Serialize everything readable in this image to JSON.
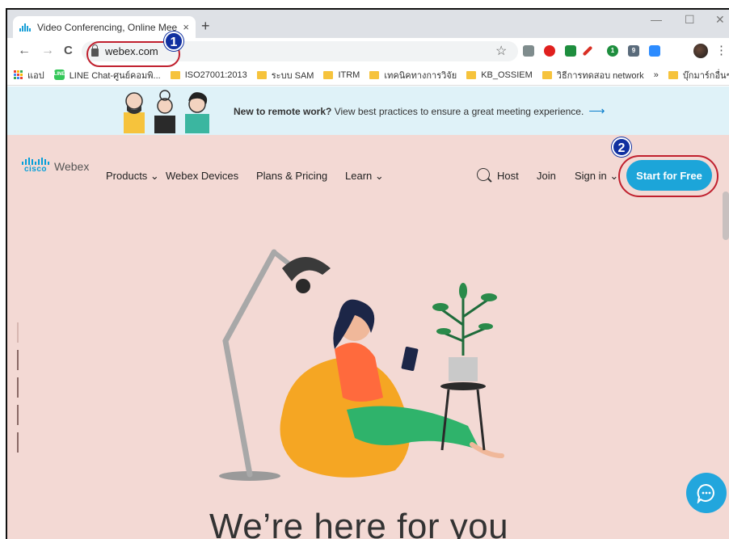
{
  "browser": {
    "tab_title": "Video Conferencing, Online Mee",
    "tab_close": "×",
    "new_tab": "+",
    "window_controls": {
      "minimize": "—",
      "maximize": "☐",
      "close": "✕"
    },
    "back": "←",
    "forward": "→",
    "reload": "C",
    "url": "webex.com",
    "bookmark_star": "☆",
    "menu": "⋮",
    "extensions": [
      {
        "icon": "g-extension-icon",
        "color": "#7f8c8d"
      },
      {
        "icon": "opera-icon",
        "color": "#e0201e"
      },
      {
        "icon": "cast-icon",
        "color": "#1e8e3e"
      },
      {
        "icon": "hammer-icon",
        "color": "#d93025"
      },
      {
        "icon": "extension-badge-icon",
        "color": "#1e8e3e",
        "badge": "1"
      },
      {
        "icon": "gmail-badge-icon",
        "color": "#5a6b7b",
        "badge": "9"
      },
      {
        "icon": "zoom-icon",
        "color": "#2d8cff"
      }
    ]
  },
  "bookmarks": {
    "apps_label": "แอป",
    "items": [
      {
        "label": "LINE Chat-ศูนย์คอมพิ...",
        "icon": "line-icon"
      },
      {
        "label": "ISO27001:2013",
        "icon": "folder-icon"
      },
      {
        "label": "ระบบ SAM",
        "icon": "folder-icon"
      },
      {
        "label": "ITRM",
        "icon": "folder-icon"
      },
      {
        "label": "เทคนิคทางการวิจัย",
        "icon": "folder-icon"
      },
      {
        "label": "KB_OSSIEM",
        "icon": "folder-icon"
      },
      {
        "label": "วิธีการทดสอบ network",
        "icon": "folder-icon"
      }
    ],
    "more": "»",
    "other_bookmarks": "บุ๊กมาร์กอื่นๆ"
  },
  "banner": {
    "bold": "New to remote work?",
    "text": " View best practices to ensure a great meeting experience.",
    "arrow": "⟶"
  },
  "site_nav": {
    "logo_cisco": "cisco",
    "logo_webex": "Webex",
    "products": "Products ⌄",
    "devices": "Webex Devices",
    "pricing": "Plans & Pricing",
    "learn": "Learn ⌄",
    "host": "Host",
    "join": "Join",
    "signin": "Sign in ⌄",
    "cta": "Start for Free"
  },
  "annotations": {
    "one": "1",
    "two": "2"
  },
  "hero": {
    "headline": "We’re here for you"
  },
  "colors": {
    "page_bg": "#f3d9d4",
    "banner_bg": "#dff2f8",
    "accent": "#1ca5d9",
    "annotation_ring": "#c0202e"
  }
}
